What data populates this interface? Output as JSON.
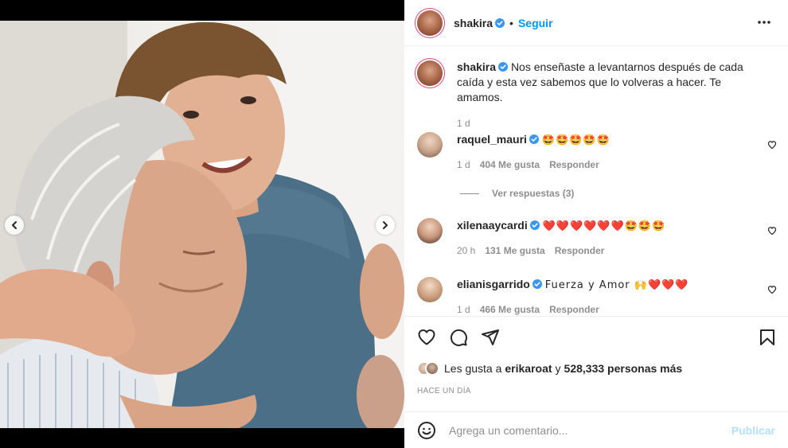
{
  "post": {
    "author": "shakira",
    "follow_label": "Seguir",
    "separator": "•"
  },
  "caption": {
    "username": "shakira",
    "text": "Nos enseñaste a levantarnos después de cada caída y esta vez sabemos que lo volveras a hacer. Te amamos.",
    "time": "1 d"
  },
  "comments": [
    {
      "username": "raquel_mauri",
      "text": "🤩🤩🤩🤩🤩",
      "time": "1 d",
      "likes": "404 Me gusta",
      "reply": "Responder"
    },
    {
      "username": "xilenaaycardi",
      "text": "❤️❤️❤️❤️❤️❤️🤩🤩🤩",
      "time": "20 h",
      "likes": "131 Me gusta",
      "reply": "Responder"
    },
    {
      "username": "elianisgarrido",
      "text": "Fuerza y Amor 🙌❤️❤️❤️",
      "time": "1 d",
      "likes": "466 Me gusta",
      "reply": "Responder"
    }
  ],
  "view_replies": "Ver respuestas (3)",
  "likes_line": {
    "prefix": "Les gusta a",
    "user": "erikaroat",
    "conj": "y",
    "count": "528,333 personas más"
  },
  "date_label": "HACE UN DÍA",
  "add_comment": {
    "placeholder": "Agrega un comentario...",
    "publish": "Publicar"
  },
  "carousel": {
    "total": 3,
    "active_index": 1
  },
  "colors": {
    "accent": "#0095f6",
    "verified": "#3897f0",
    "publish_disabled": "#b2dffc"
  },
  "icons": [
    "chevron-left-icon",
    "chevron-right-icon",
    "more-icon",
    "verified-icon",
    "heart-icon",
    "comment-icon",
    "share-icon",
    "bookmark-icon",
    "emoji-icon"
  ]
}
